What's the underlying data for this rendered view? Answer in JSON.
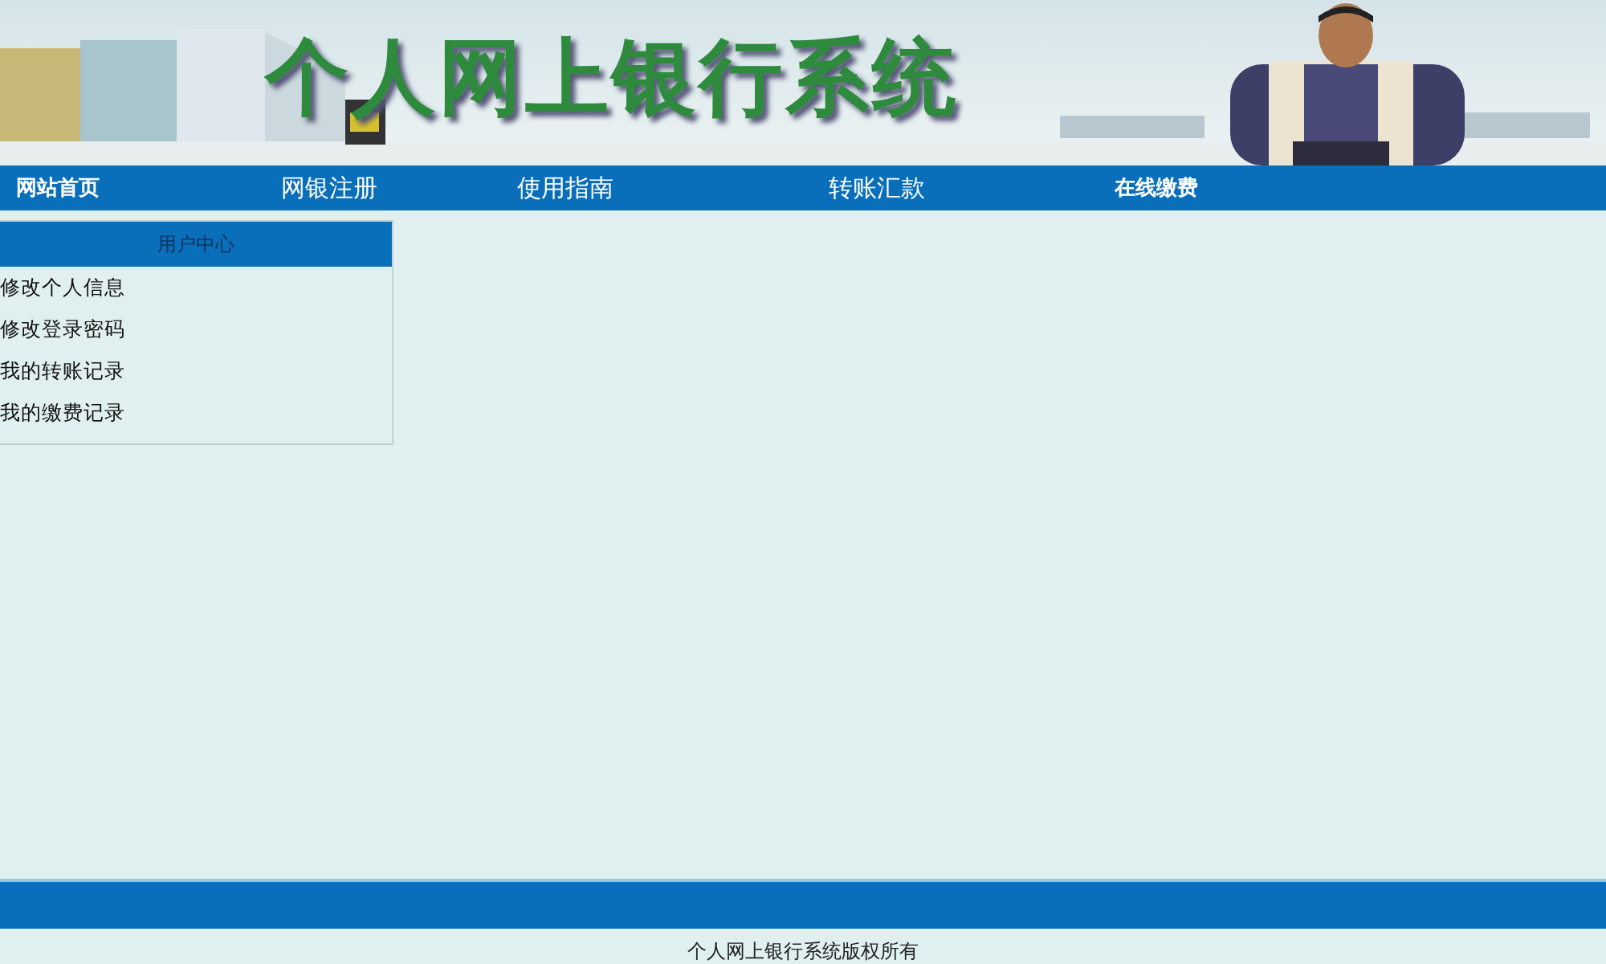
{
  "banner": {
    "title": "个人网上银行系统"
  },
  "nav": [
    {
      "label": "网站首页",
      "bold": true
    },
    {
      "label": "网银注册",
      "bold": false
    },
    {
      "label": "使用指南",
      "bold": false
    },
    {
      "label": "转账汇款",
      "bold": false
    },
    {
      "label": "在线缴费",
      "bold": true
    }
  ],
  "sidebar": {
    "title": "用户中心",
    "items": [
      "修改个人信息",
      "修改登录密码",
      "我的转账记录",
      "我的缴费记录"
    ]
  },
  "footer": {
    "text": "个人网上银行系统版权所有"
  }
}
